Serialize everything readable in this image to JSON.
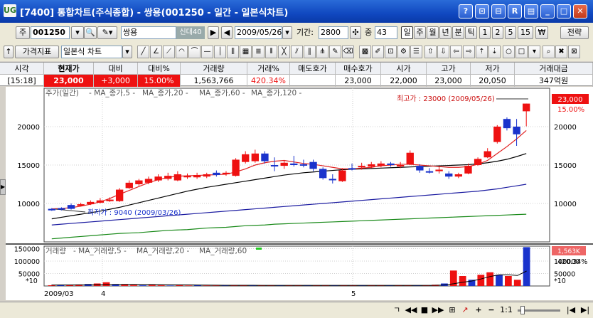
{
  "window": {
    "logo": "UG",
    "title": "[7400] 통합차트(주식종합) - 쌍용(001250 - 일간 - 일본식차트)",
    "buttons": [
      "?",
      "⊡",
      "⊟",
      "R",
      "▤",
      "_",
      "□",
      "✕"
    ]
  },
  "toolbar": {
    "market": "주",
    "code": "001250",
    "name": "쌍용",
    "credit_badge": "신대40",
    "date": "2009/05/26",
    "period_label": "기간:",
    "period_value": "2800",
    "count_label": "중",
    "count_value": "43",
    "timeframes": [
      "일",
      "주",
      "월",
      "년",
      "분",
      "틱",
      "1",
      "2",
      "5",
      "15",
      "₩"
    ],
    "strategy": "전략"
  },
  "toolbar2": {
    "indicator_button": "가격지표",
    "chart_type": "일본식 차트"
  },
  "quote": {
    "headers": [
      "시각",
      "현재가",
      "대비",
      "대비%",
      "거래량",
      "거래%",
      "매도호가",
      "매수호가",
      "시가",
      "고가",
      "저가",
      "거래대금"
    ],
    "values": [
      "[15:18]",
      "23,000",
      "+3,000",
      "15.00%",
      "1,563,766",
      "420.34%",
      "",
      "23,000",
      "22,000",
      "23,000",
      "20,050",
      "347억원"
    ]
  },
  "price_panel": {
    "legend": [
      {
        "text": "주가(일간)",
        "color": "#555555"
      },
      {
        "text": "MA_종가,5",
        "color": "#e02020"
      },
      {
        "text": "MA_종가,20",
        "color": "#000000"
      },
      {
        "text": "MA_종가,60",
        "color": "#1a1aa0"
      },
      {
        "text": "MA_종가,120",
        "color": "#1a8a1a"
      }
    ],
    "y_ticks": [
      "20000",
      "15000",
      "10000"
    ],
    "current_price_tag": "23,000",
    "current_change_tag": "15.00%",
    "high_annotation": "최고가 : 23000 (2009/05/26)",
    "low_annotation": "최저가 : 9040 (2009/03/26)"
  },
  "volume_panel": {
    "legend": [
      {
        "text": "거래량",
        "color": "#555555"
      },
      {
        "text": "MA_거래량,5",
        "color": "#e02020"
      },
      {
        "text": "MA_거래량,20",
        "color": "#000000"
      },
      {
        "text": "MA_거래량,60",
        "color": "#e02020"
      }
    ],
    "y_ticks": [
      "150000",
      "100000",
      "50000"
    ],
    "unit": "*10",
    "current_volume_tag": "1,563K",
    "current_pct_tag": "420.34%"
  },
  "x_axis": {
    "labels": [
      "2009/03",
      "4",
      "5"
    ]
  },
  "chart_data": {
    "type": "candlestick",
    "ylim": [
      5000,
      25000
    ],
    "candles": [
      {
        "o": 9300,
        "c": 9100,
        "h": 9400,
        "l": 9040
      },
      {
        "o": 9400,
        "c": 9200,
        "h": 9500,
        "l": 9100
      },
      {
        "o": 9800,
        "c": 9300,
        "h": 10000,
        "l": 9200
      },
      {
        "o": 9700,
        "c": 9900,
        "h": 10100,
        "l": 9600
      },
      {
        "o": 9900,
        "c": 10200,
        "h": 10400,
        "l": 9800
      },
      {
        "o": 10100,
        "c": 10400,
        "h": 10700,
        "l": 10000
      },
      {
        "o": 10300,
        "c": 10500,
        "h": 10800,
        "l": 10200
      },
      {
        "o": 10300,
        "c": 11800,
        "h": 12000,
        "l": 10200
      },
      {
        "o": 12000,
        "c": 12700,
        "h": 13000,
        "l": 11900
      },
      {
        "o": 12500,
        "c": 13000,
        "h": 13200,
        "l": 12300
      },
      {
        "o": 12700,
        "c": 13200,
        "h": 13500,
        "l": 12500
      },
      {
        "o": 13000,
        "c": 13500,
        "h": 13800,
        "l": 12800
      },
      {
        "o": 13200,
        "c": 13600,
        "h": 14000,
        "l": 13000
      },
      {
        "o": 13000,
        "c": 13800,
        "h": 14200,
        "l": 12900
      },
      {
        "o": 13400,
        "c": 13600,
        "h": 13900,
        "l": 13200
      },
      {
        "o": 13400,
        "c": 13700,
        "h": 14000,
        "l": 13200
      },
      {
        "o": 13500,
        "c": 13800,
        "h": 14000,
        "l": 13300
      },
      {
        "o": 14000,
        "c": 13700,
        "h": 14300,
        "l": 13500
      },
      {
        "o": 13800,
        "c": 14000,
        "h": 14200,
        "l": 13600
      },
      {
        "o": 13600,
        "c": 15700,
        "h": 15900,
        "l": 13500
      },
      {
        "o": 15400,
        "c": 16400,
        "h": 16800,
        "l": 15200
      },
      {
        "o": 15500,
        "c": 16500,
        "h": 17000,
        "l": 15300
      },
      {
        "o": 16500,
        "c": 15500,
        "h": 16800,
        "l": 15200
      },
      {
        "o": 15000,
        "c": 14900,
        "h": 16000,
        "l": 14200
      },
      {
        "o": 14900,
        "c": 15300,
        "h": 15600,
        "l": 14500
      },
      {
        "o": 15200,
        "c": 15000,
        "h": 16200,
        "l": 14800
      },
      {
        "o": 15100,
        "c": 15000,
        "h": 15700,
        "l": 14700
      },
      {
        "o": 15400,
        "c": 14500,
        "h": 15700,
        "l": 14200
      },
      {
        "o": 14500,
        "c": 13300,
        "h": 14700,
        "l": 13100
      },
      {
        "o": 13200,
        "c": 13100,
        "h": 13800,
        "l": 12600
      },
      {
        "o": 12900,
        "c": 14300,
        "h": 14600,
        "l": 12800
      },
      {
        "o": 14600,
        "c": 14500,
        "h": 15200,
        "l": 14300
      },
      {
        "o": 14700,
        "c": 14900,
        "h": 15300,
        "l": 14400
      },
      {
        "o": 14800,
        "c": 15100,
        "h": 15400,
        "l": 14600
      },
      {
        "o": 14900,
        "c": 15200,
        "h": 15500,
        "l": 14700
      },
      {
        "o": 15200,
        "c": 15000,
        "h": 15400,
        "l": 14800
      },
      {
        "o": 14900,
        "c": 15000,
        "h": 15400,
        "l": 14600
      },
      {
        "o": 15100,
        "c": 16600,
        "h": 16900,
        "l": 15000
      },
      {
        "o": 14900,
        "c": 14300,
        "h": 15100,
        "l": 14000
      },
      {
        "o": 14200,
        "c": 14100,
        "h": 14600,
        "l": 13900
      },
      {
        "o": 14200,
        "c": 14400,
        "h": 14800,
        "l": 13900
      },
      {
        "o": 13900,
        "c": 13500,
        "h": 14200,
        "l": 13200
      },
      {
        "o": 13500,
        "c": 13800,
        "h": 14000,
        "l": 13300
      },
      {
        "o": 13900,
        "c": 14900,
        "h": 15200,
        "l": 13800
      },
      {
        "o": 15000,
        "c": 15800,
        "h": 16000,
        "l": 14900
      },
      {
        "o": 16000,
        "c": 16800,
        "h": 17200,
        "l": 15900
      },
      {
        "o": 18000,
        "c": 20000,
        "h": 20200,
        "l": 17800
      },
      {
        "o": 21000,
        "c": 19800,
        "h": 21200,
        "l": 19500
      },
      {
        "o": 20000,
        "c": 19000,
        "h": 21000,
        "l": 17500
      },
      {
        "o": 22000,
        "c": 23000,
        "h": 23000,
        "l": 20050
      }
    ],
    "ma5": [
      9300,
      9350,
      9450,
      9650,
      9900,
      10200,
      10650,
      11200,
      11700,
      12200,
      12700,
      13100,
      13400,
      13550,
      13600,
      13650,
      13700,
      13750,
      13800,
      14100,
      14500,
      15000,
      15300,
      15500,
      15600,
      15400,
      15200,
      15100,
      14900,
      14700,
      14500,
      14500,
      14600,
      14700,
      14900,
      15000,
      15100,
      15100,
      15000,
      14900,
      14800,
      14700,
      14700,
      14800,
      15100,
      15600,
      16500,
      17400,
      18400,
      19500
    ],
    "ma20": [
      8000,
      8200,
      8400,
      8600,
      8800,
      9000,
      9250,
      9500,
      9800,
      10100,
      10400,
      10700,
      11000,
      11300,
      11600,
      11850,
      12100,
      12300,
      12500,
      12700,
      12900,
      13100,
      13300,
      13500,
      13700,
      13850,
      14000,
      14100,
      14200,
      14300,
      14400,
      14450,
      14500,
      14550,
      14600,
      14650,
      14700,
      14750,
      14800,
      14850,
      14900,
      14950,
      15000,
      15050,
      15150,
      15300,
      15500,
      15750,
      16100,
      16500
    ],
    "ma60": [
      7200,
      7300,
      7400,
      7500,
      7600,
      7700,
      7800,
      7900,
      8000,
      8100,
      8200,
      8300,
      8400,
      8500,
      8600,
      8700,
      8800,
      8900,
      9000,
      9100,
      9200,
      9300,
      9400,
      9500,
      9600,
      9700,
      9800,
      9900,
      10000,
      10100,
      10200,
      10300,
      10400,
      10500,
      10600,
      10700,
      10800,
      10900,
      11000,
      11100,
      11200,
      11300,
      11400,
      11500,
      11600,
      11750,
      11900,
      12100,
      12300,
      12500
    ],
    "ma120": [
      5400,
      5500,
      5600,
      5700,
      5800,
      5900,
      6000,
      6100,
      6150,
      6200,
      6300,
      6400,
      6500,
      6550,
      6600,
      6700,
      6800,
      6850,
      6900,
      7000,
      7100,
      7150,
      7200,
      7300,
      7350,
      7400,
      7450,
      7500,
      7550,
      7600,
      7650,
      7700,
      7750,
      7800,
      7850,
      7900,
      7950,
      8000,
      8050,
      8100,
      8150,
      8200,
      8250,
      8300,
      8350,
      8400,
      8450,
      8500,
      8550,
      8600
    ],
    "volume": [
      3000,
      5000,
      4000,
      6000,
      8000,
      10000,
      15000,
      7000,
      5000,
      4000,
      3000,
      4000,
      3000,
      2000,
      3000,
      2000,
      3000,
      2000,
      2000,
      4000,
      3000,
      2000,
      3000,
      2000,
      2000,
      2000,
      2000,
      3000,
      3000,
      2000,
      3000,
      2000,
      2000,
      2000,
      2000,
      2000,
      2000,
      2000,
      2000,
      2000,
      2000,
      2000,
      5000,
      10000,
      62000,
      40000,
      25000,
      45000,
      55000,
      45000,
      40000,
      25000,
      156000
    ],
    "volume_ylim": [
      0,
      160000
    ],
    "volume_ma": [
      4000,
      4200,
      4400,
      4500,
      4800,
      5200,
      6000,
      6500,
      6800,
      7000,
      6800,
      6500,
      6000,
      5500,
      5000,
      4500,
      4000,
      3500,
      3200,
      3000,
      2900,
      2800,
      2700,
      2600,
      2600,
      2500,
      2500,
      2500,
      2500,
      2500,
      2500,
      2500,
      2400,
      2400,
      2400,
      2400,
      2400,
      2400,
      2400,
      2400,
      2400,
      2500,
      2800,
      4000,
      9000,
      15000,
      20000,
      28000,
      38000,
      45000,
      45000,
      42000,
      60000
    ]
  },
  "status_bar": [
    "ㄱ",
    "◀◀",
    "■",
    "▶▶",
    "⊞",
    "↗",
    "+",
    "−",
    "1:1",
    "|◀",
    "▶|"
  ],
  "colors": {
    "up": "#ee1111",
    "down": "#1a33cc",
    "accent": "#1048c0"
  }
}
